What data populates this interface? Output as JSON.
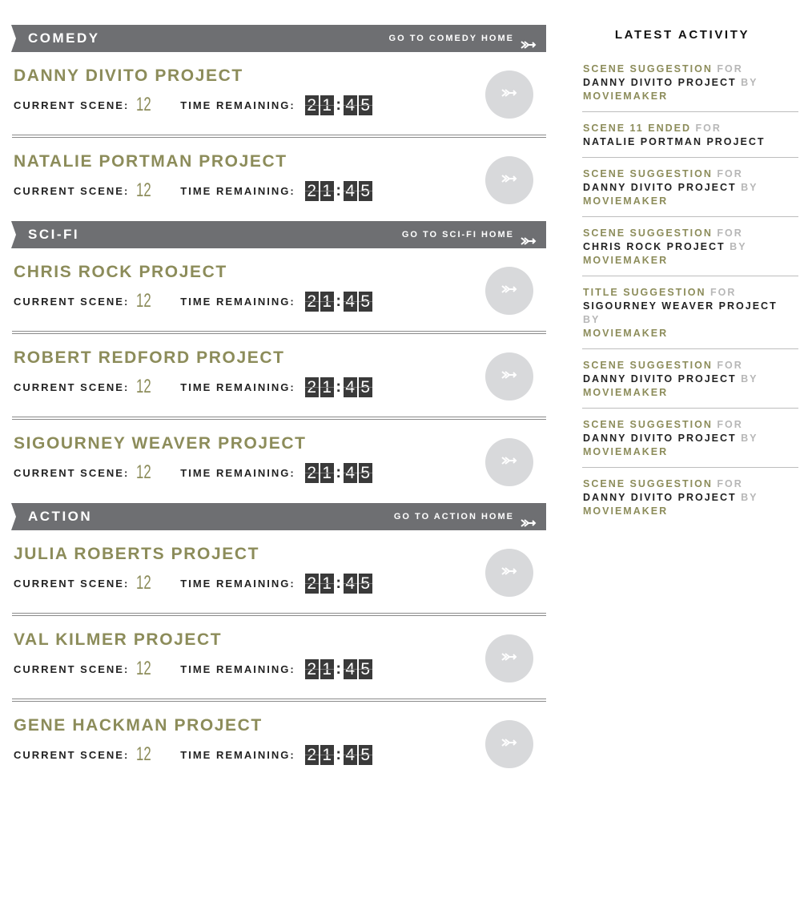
{
  "labels": {
    "current_scene": "CURRENT SCENE:",
    "time_remaining": "TIME REMAINING:"
  },
  "categories": [
    {
      "name": "COMEDY",
      "link": "GO TO COMEDY HOME",
      "projects": [
        {
          "title": "DANNY DIVITO PROJECT",
          "scene": "12",
          "time": [
            "2",
            "1",
            "4",
            "5"
          ]
        },
        {
          "title": "NATALIE PORTMAN PROJECT",
          "scene": "12",
          "time": [
            "2",
            "1",
            "4",
            "5"
          ]
        }
      ]
    },
    {
      "name": "SCI-FI",
      "link": "GO TO SCI-FI HOME",
      "projects": [
        {
          "title": "CHRIS ROCK PROJECT",
          "scene": "12",
          "time": [
            "2",
            "1",
            "4",
            "5"
          ]
        },
        {
          "title": "ROBERT REDFORD PROJECT",
          "scene": "12",
          "time": [
            "2",
            "1",
            "4",
            "5"
          ]
        },
        {
          "title": "SIGOURNEY WEAVER PROJECT",
          "scene": "12",
          "time": [
            "2",
            "1",
            "4",
            "5"
          ]
        }
      ]
    },
    {
      "name": "ACTION",
      "link": "GO TO ACTION HOME",
      "projects": [
        {
          "title": "JULIA ROBERTS PROJECT",
          "scene": "12",
          "time": [
            "2",
            "1",
            "4",
            "5"
          ]
        },
        {
          "title": "VAL KILMER PROJECT",
          "scene": "12",
          "time": [
            "2",
            "1",
            "4",
            "5"
          ]
        },
        {
          "title": "GENE HACKMAN PROJECT",
          "scene": "12",
          "time": [
            "2",
            "1",
            "4",
            "5"
          ]
        }
      ]
    }
  ],
  "activity": {
    "title": "LATEST ACTIVITY",
    "items": [
      {
        "type": "SCENE SUGGESTION",
        "for": "FOR",
        "project": "DANNY DIVITO PROJECT",
        "by": "BY",
        "user": "MOVIEMAKER"
      },
      {
        "type": "SCENE 11 ENDED",
        "for": "FOR",
        "project": "NATALIE PORTMAN PROJECT",
        "by": "",
        "user": ""
      },
      {
        "type": "SCENE SUGGESTION",
        "for": "FOR",
        "project": "DANNY DIVITO PROJECT",
        "by": "BY",
        "user": "MOVIEMAKER"
      },
      {
        "type": "SCENE SUGGESTION",
        "for": "FOR",
        "project": "CHRIS ROCK PROJECT",
        "by": "BY",
        "user": "MOVIEMAKER"
      },
      {
        "type": "TITLE SUGGESTION",
        "for": "FOR",
        "project": "SIGOURNEY WEAVER PROJECT",
        "by": "BY",
        "user": "MOVIEMAKER"
      },
      {
        "type": "SCENE SUGGESTION",
        "for": "FOR",
        "project": "DANNY DIVITO PROJECT",
        "by": "BY",
        "user": "MOVIEMAKER"
      },
      {
        "type": "SCENE SUGGESTION",
        "for": "FOR",
        "project": "DANNY DIVITO PROJECT",
        "by": "BY",
        "user": "MOVIEMAKER"
      },
      {
        "type": "SCENE SUGGESTION",
        "for": "FOR",
        "project": "DANNY DIVITO PROJECT",
        "by": "BY",
        "user": "MOVIEMAKER"
      }
    ]
  }
}
